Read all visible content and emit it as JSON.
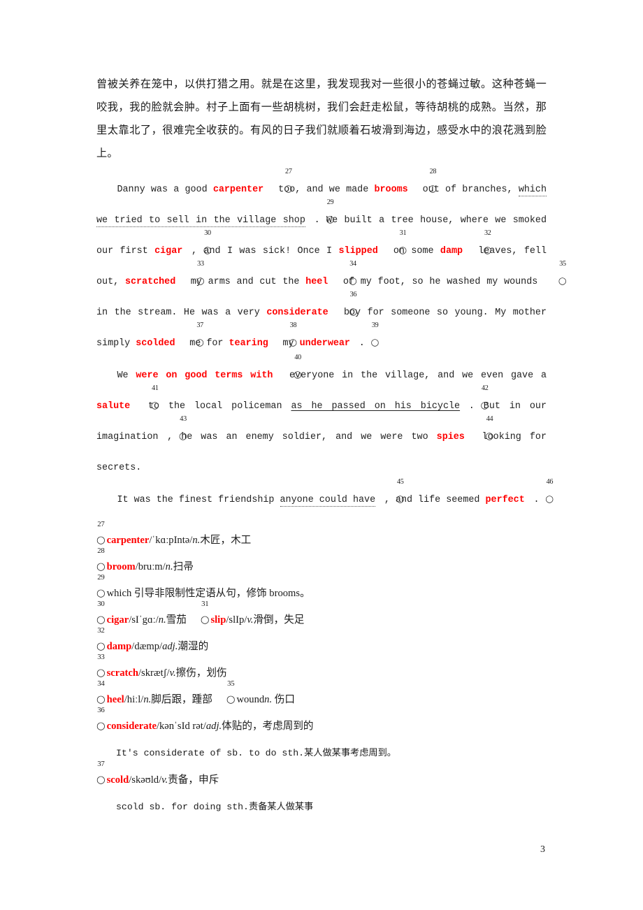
{
  "document": {
    "page_number": "3",
    "accent_color": "#ff0000"
  },
  "translation_paragraph": {
    "text": "曾被关养在笼中，以供打猎之用。就是在这里，我发现我对一些很小的苍蝇过敏。这种苍蝇一咬我，我的脸就会肿。村子上面有一些胡桃树，我们会赶走松鼠，等待胡桃的成熟。当然，那里太靠北了，很难完全收获的。有风的日子我们就顺着石坡滑到海边，感受水中的浪花溅到脸上。"
  },
  "passage": {
    "paragraph1": {
      "seg1": "Danny was a good ",
      "kw1": "carpenter",
      "mk1": "27",
      "seg2": " too, and we made ",
      "kw2": "brooms",
      "mk2": "28",
      "seg3": " out of branches, ",
      "ul1": "which we tried to sell in the village shop",
      "mk3": "29",
      "seg4": ". We built a tree house, where we smoked our first ",
      "kw3": "cigar",
      "mk4": "30",
      "seg5": ",   and I was sick! Once I ",
      "kw4": "slipped",
      "mk5": "31",
      "seg6": " on some ",
      "kw5": "damp",
      "mk6": "32",
      "seg7": " leaves, fell out, ",
      "kw6": "scratched",
      "mk7": "33",
      "seg8": " my arms and cut the ",
      "kw7": "heel",
      "mk8": "34",
      "seg9": " of my foot, so he washed my wounds",
      "mk9": "35",
      "seg10": " in the stream. He was a very ",
      "kw8": "considerate",
      "mk10": "36",
      "seg11": " boy for someone so young. My mother simply ",
      "kw9": "scolded",
      "mk11": "37",
      "seg12": " me for ",
      "kw10": "tearing",
      "mk12": "38",
      "seg13": " my ",
      "kw11": "underwear",
      "mk13": "39",
      "seg14": "."
    },
    "paragraph2": {
      "seg1": "We ",
      "kw1": "were on good terms with",
      "mk1": "40",
      "seg2": " everyone in the village, and we even gave a ",
      "kw2": "salute",
      "mk2": "41",
      "seg3": " to the local policeman ",
      "ul1": "as he passed on his bicycle",
      "mk3": "42",
      "seg4": ". But in our imagination",
      "mk4": "43",
      "seg5": ", he was an enemy soldier, and we were two ",
      "kw3": "spies",
      "mk5": "44",
      "seg6": " looking for secrets."
    },
    "paragraph3": {
      "seg1": "It  was  the  finest  friendship  ",
      "ul1": "anyone  could  have",
      "mk1": "45",
      "seg2": ",    and  life  seemed ",
      "kw1": "perfect",
      "mk2": "46",
      "seg3": "."
    }
  },
  "notes": [
    {
      "id": "note-27",
      "marker": "27",
      "word": "carpenter",
      "word_red": true,
      "phonetic": "/ˈkɑːpIntə/",
      "pos": "n.",
      "gloss": "木匠，木工"
    },
    {
      "id": "note-28",
      "marker": "28",
      "word": "broom",
      "word_red": true,
      "phonetic": "/bruːm/",
      "pos": "n.",
      "gloss": "扫帚"
    },
    {
      "id": "note-29",
      "marker": "29",
      "word": "which",
      "word_red": false,
      "phonetic": "",
      "pos": "",
      "gloss": " 引导非限制性定语从句，修饰 brooms。"
    },
    {
      "id": "note-30",
      "marker": "30",
      "word": "cigar",
      "word_red": true,
      "phonetic": "/sIˈgɑː/",
      "pos": "n.",
      "gloss": "雪茄",
      "second": {
        "marker": "31",
        "word": "slip",
        "word_red": true,
        "phonetic": "/slIp/",
        "pos": "v.",
        "gloss": "滑倒，失足"
      }
    },
    {
      "id": "note-32",
      "marker": "32",
      "word": "damp",
      "word_red": true,
      "phonetic": "/dæmp/",
      "pos": "adj.",
      "gloss": "潮湿的"
    },
    {
      "id": "note-33",
      "marker": "33",
      "word": "scratch",
      "word_red": true,
      "phonetic": "/skrætʃ/",
      "pos": "v.",
      "gloss": "擦伤，划伤"
    },
    {
      "id": "note-34",
      "marker": "34",
      "word": "heel",
      "word_red": true,
      "phonetic": "/hiːl/",
      "pos": "n.",
      "gloss": "脚后跟，踵部",
      "second": {
        "marker": "35",
        "word": "wound",
        "word_red": false,
        "phonetic": "",
        "pos": "n.",
        "gloss": " 伤口"
      }
    },
    {
      "id": "note-36",
      "marker": "36",
      "word": "considerate",
      "word_red": true,
      "phonetic": "/kənˈsId  rət/",
      "pos": "adj.",
      "gloss": "体贴的，考虑周到的"
    },
    {
      "id": "note-36-example",
      "marker": "",
      "example": "It's considerate of sb. to do sth.",
      "example_gloss": "某人做某事考虑周到。"
    },
    {
      "id": "note-37",
      "marker": "37",
      "word": "scold",
      "word_red": true,
      "phonetic": "/skəʊld/",
      "pos": "v.",
      "gloss": "责备，申斥"
    },
    {
      "id": "note-37-example",
      "marker": "",
      "example": "scold sb. for doing sth.",
      "example_gloss": "责备某人做某事"
    }
  ]
}
